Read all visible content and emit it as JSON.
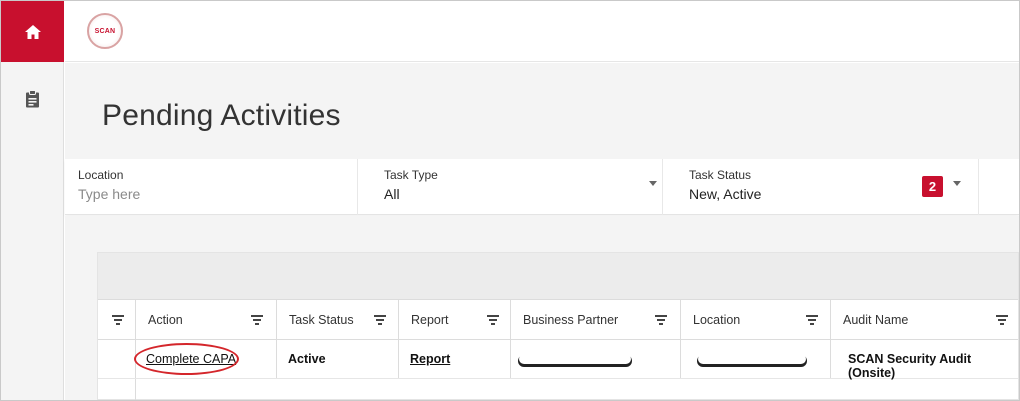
{
  "app": {
    "logo_text": "SCAN",
    "home_icon": "home-icon",
    "task_icon": "clipboard-icon"
  },
  "page": {
    "title": "Pending Activities"
  },
  "filters": {
    "location": {
      "label": "Location",
      "placeholder": "Type here"
    },
    "task_type": {
      "label": "Task Type",
      "value": "All"
    },
    "task_status": {
      "label": "Task Status",
      "value": "New, Active",
      "count": "2"
    }
  },
  "table": {
    "headers": {
      "action": "Action",
      "task_status": "Task Status",
      "report": "Report",
      "business_partner": "Business Partner",
      "location": "Location",
      "audit_name": "Audit Name"
    },
    "rows": [
      {
        "action": "Complete CAPA",
        "task_status": "Active",
        "report": "Report",
        "business_partner": "",
        "location": "",
        "audit_name": "SCAN Security Audit (Onsite)"
      }
    ]
  },
  "colors": {
    "accent": "#c8102e",
    "annotation": "#d4262b",
    "background": "#f4f4f4"
  }
}
